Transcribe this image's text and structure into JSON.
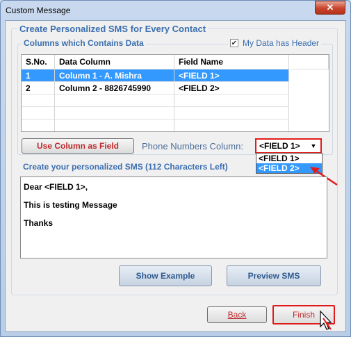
{
  "window": {
    "title": "Custom Message",
    "close_label": "✕"
  },
  "outer_group": {
    "title": "Create Personalized SMS for Every Contact"
  },
  "columns_group": {
    "title": "Columns which Contains Data",
    "header_checkbox": {
      "label": "My Data has Header",
      "checked": true,
      "check_glyph": "✔"
    }
  },
  "grid": {
    "headers": [
      "S.No.",
      "Data Column",
      "Field Name"
    ],
    "rows": [
      {
        "sno": "1",
        "column": "Column 1 - A. Mishra",
        "field": "<FIELD 1>",
        "selected": true
      },
      {
        "sno": "2",
        "column": "Column 2 - 8826745990",
        "field": "<FIELD 2>",
        "selected": false
      }
    ]
  },
  "use_column_button": "Use Column as Field",
  "phone_numbers": {
    "label": "Phone Numbers Column:",
    "selected": "<FIELD 1>",
    "options": [
      "<FIELD 1>",
      "<FIELD 2>"
    ],
    "highlighted": "<FIELD 2>",
    "arrow_glyph": "▼"
  },
  "sms": {
    "title": "Create your personalized SMS (112 Characters Left)",
    "lines": [
      "Dear <FIELD 1>,",
      "This is testing Message",
      "Thanks"
    ]
  },
  "buttons": {
    "show_example": "Show Example",
    "preview": "Preview SMS",
    "back": "Back",
    "finish": "Finish"
  },
  "colors": {
    "accent": "#3c6fb0",
    "selection": "#3399ff",
    "highlight_red": "#e11b1b"
  }
}
